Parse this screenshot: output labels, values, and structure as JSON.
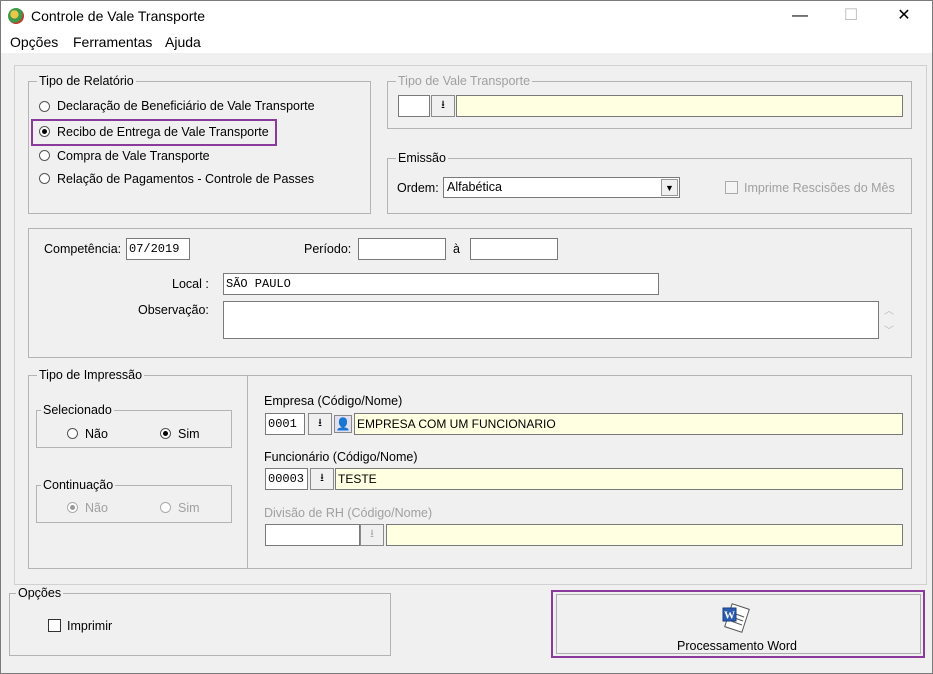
{
  "window": {
    "title": "Controle de Vale Transporte",
    "minimize": "—",
    "maximize": "☐",
    "close": "✕"
  },
  "menu": [
    "Opções",
    "Ferramentas",
    "Ajuda"
  ],
  "tipo_relatorio": {
    "legend": "Tipo de Relatório",
    "options": [
      "Declaração de Beneficiário de Vale Transporte",
      "Recibo de Entrega de Vale Transporte",
      "Compra de Vale Transporte",
      "Relação de Pagamentos - Controle de Passes"
    ],
    "selected_index": 1
  },
  "tipo_vale": {
    "legend": "Tipo de Vale Transporte",
    "code": "",
    "name": ""
  },
  "emissao": {
    "legend": "Emissão",
    "ordem_label": "Ordem:",
    "ordem_value": "Alfabética",
    "imprime_rescisoes_label": "Imprime Rescisões do Mês"
  },
  "dados": {
    "competencia_label": "Competência:",
    "competencia_value": "07/2019",
    "periodo_label": "Período:",
    "periodo_de": "",
    "periodo_a_label": "à",
    "periodo_ate": "",
    "local_label": "Local :",
    "local_value": "SÃO PAULO",
    "observacao_label": "Observação:",
    "observacao_value": ""
  },
  "tipo_impressao": {
    "legend": "Tipo de Impressão",
    "selecionado": {
      "legend": "Selecionado",
      "nao": "Não",
      "sim": "Sim",
      "selected": "Sim"
    },
    "continuacao": {
      "legend": "Continuação",
      "nao": "Não",
      "sim": "Sim",
      "selected": "Não"
    }
  },
  "empresa": {
    "label": "Empresa (Código/Nome)",
    "code": "0001",
    "name": "EMPRESA COM UM FUNCIONARIO"
  },
  "funcionario": {
    "label": "Funcionário (Código/Nome)",
    "code": "00003",
    "name": "TESTE"
  },
  "divisao": {
    "label": "Divisão de RH (Código/Nome)",
    "code": "",
    "name": ""
  },
  "opcoes": {
    "legend": "Opções",
    "imprimir_label": "Imprimir"
  },
  "processamento": {
    "label": "Processamento Word",
    "icon": "word-document-icon"
  }
}
